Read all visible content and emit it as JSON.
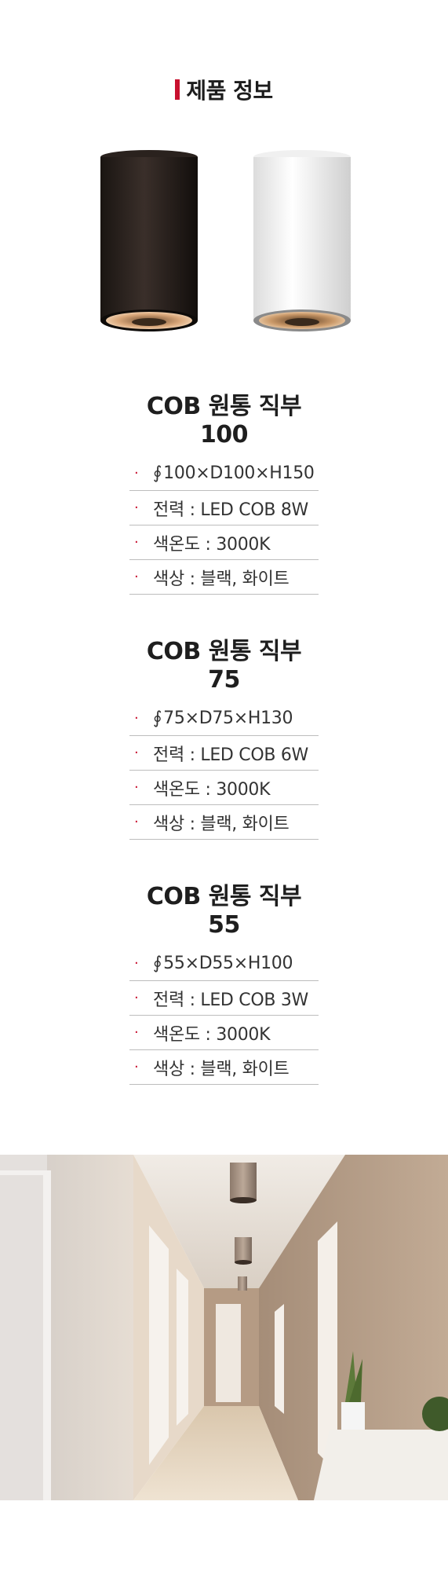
{
  "section_title": "제품 정보",
  "specs": [
    {
      "title": "COB 원통 직부 100",
      "size_symbol": "∮",
      "size": "100×D100×H150",
      "power": "전력 : LED COB 8W",
      "temperature": "색온도 : 3000K",
      "color": "색상 : 블랙, 화이트"
    },
    {
      "title": "COB 원통 직부 75",
      "size_symbol": "∮",
      "size": "75×D75×H130",
      "power": "전력 : LED COB 6W",
      "temperature": "색온도 : 3000K",
      "color": "색상 : 블랙, 화이트"
    },
    {
      "title": "COB 원통 직부 55",
      "size_symbol": "∮",
      "size": "55×D55×H100",
      "power": "전력 : LED COB 3W",
      "temperature": "색온도 : 3000K",
      "color": "색상 : 블랙, 화이트"
    }
  ],
  "bullet": "·",
  "colors": {
    "accent": "#c8102e",
    "divider": "#bdbdbd"
  }
}
